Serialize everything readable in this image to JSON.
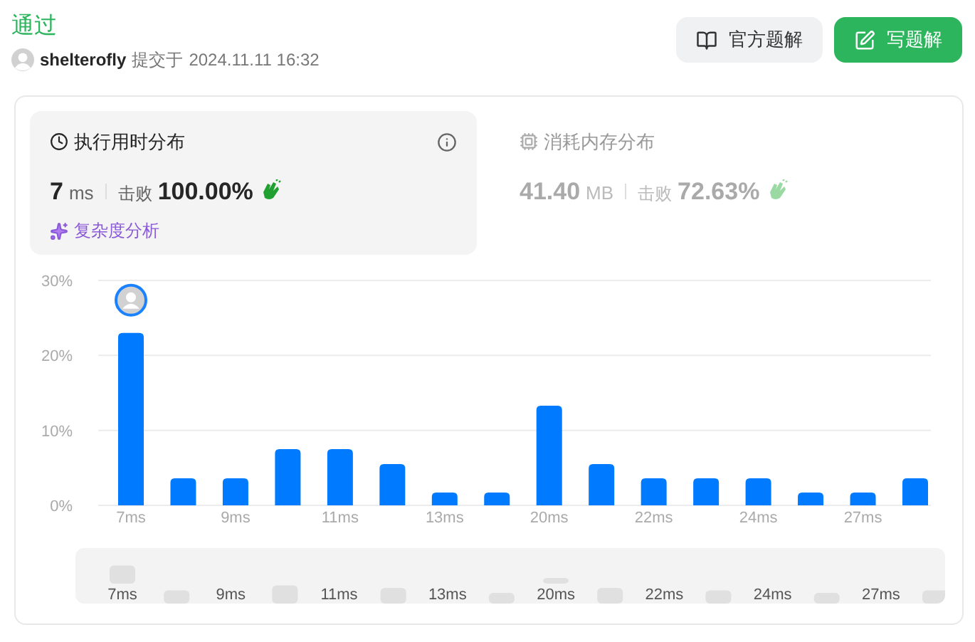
{
  "status": "通过",
  "submission": {
    "user": "shelterofly",
    "submitted_label": "提交于",
    "time": "2024.11.11 16:32"
  },
  "buttons": [
    {
      "label": "官方题解",
      "kind": "secondary"
    },
    {
      "label": "写题解",
      "kind": "primary"
    }
  ],
  "panels": [
    {
      "kind": "time",
      "title": "执行用时分布",
      "value": "7",
      "unit": "ms",
      "beat_label": "击败",
      "beat": "100.00%",
      "selected": true,
      "link": "复杂度分析"
    },
    {
      "kind": "memory",
      "title": "消耗内存分布",
      "value": "41.40",
      "unit": "MB",
      "beat_label": "击败",
      "beat": "72.63%",
      "selected": false
    }
  ],
  "chart_data": {
    "type": "bar",
    "categories": [
      "7ms",
      null,
      "9ms",
      null,
      "11ms",
      null,
      "13ms",
      null,
      "20ms",
      null,
      "22ms",
      null,
      "24ms",
      null,
      "27ms",
      null
    ],
    "series": [
      {
        "color": "#007aff",
        "values": [
          23,
          3.6,
          3.6,
          7.5,
          7.5,
          5.5,
          1.7,
          1.7,
          13.3,
          5.5,
          3.6,
          3.6,
          3.6,
          1.7,
          1.7,
          3.6
        ]
      }
    ],
    "ylim": [
      0,
      30
    ],
    "yticks": [
      {
        "value": 0,
        "label": "0%"
      },
      {
        "value": 10,
        "label": "10%"
      },
      {
        "value": 20,
        "label": "20%"
      },
      {
        "value": 30,
        "label": "30%"
      }
    ]
  },
  "navigator": {
    "labels": [
      "7ms",
      "9ms",
      "11ms",
      "13ms",
      "20ms",
      "22ms",
      "24ms",
      "27ms"
    ]
  }
}
